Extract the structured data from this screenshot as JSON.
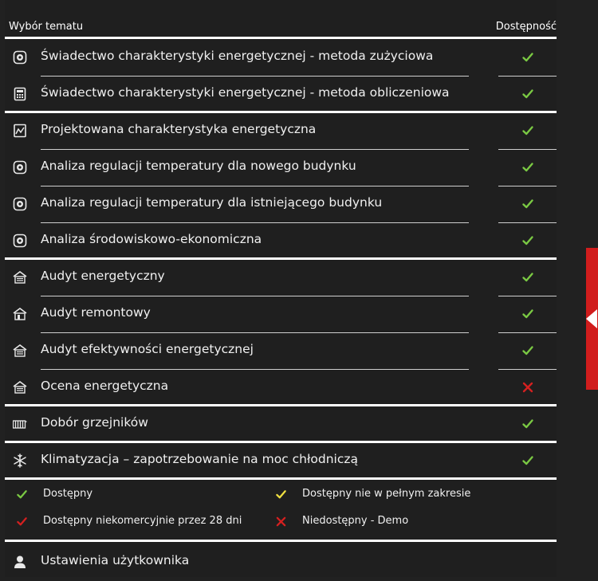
{
  "header": {
    "topic": "Wybór tematu",
    "availability": "Dostępność"
  },
  "colors": {
    "check": "#7ac943",
    "partial": "#f0e040",
    "noncommercial": "#d42020",
    "unavailable": "#d42020",
    "side_tab": "#d11d1d"
  },
  "topics": [
    {
      "label": "Świadectwo charakterystyki energetycznej - metoda zużyciowa",
      "icon": "meter-icon",
      "status": "available"
    },
    {
      "label": "Świadectwo charakterystyki energetycznej - metoda obliczeniowa",
      "icon": "calculator-icon",
      "status": "available"
    },
    {
      "label": "Projektowana charakterystyka energetyczna",
      "icon": "chart-doc-icon",
      "status": "available"
    },
    {
      "label": "Analiza regulacji temperatury dla nowego budynku",
      "icon": "meter-icon",
      "status": "available"
    },
    {
      "label": "Analiza regulacji temperatury dla istniejącego budynku",
      "icon": "meter-icon",
      "status": "available"
    },
    {
      "label": "Analiza środowiskowo-ekonomiczna",
      "icon": "meter-icon",
      "status": "available"
    },
    {
      "label": "Audyt energetyczny",
      "icon": "house-lines-icon",
      "status": "available"
    },
    {
      "label": "Audyt remontowy",
      "icon": "house-door-icon",
      "status": "available"
    },
    {
      "label": "Audyt efektywności energetycznej",
      "icon": "house-lines-icon",
      "status": "available"
    },
    {
      "label": "Ocena energetyczna",
      "icon": "house-lines-icon",
      "status": "unavailable"
    },
    {
      "label": "Dobór grzejników",
      "icon": "radiator-icon",
      "status": "available"
    },
    {
      "label": "Klimatyzacja – zapotrzebowanie na moc chłodniczą",
      "icon": "snowflake-icon",
      "status": "available"
    }
  ],
  "legend": {
    "available": "Dostępny",
    "partial": "Dostępny nie w pełnym zakresie",
    "noncommercial": "Dostępny niekomercyjnie przez 28 dni",
    "unavailable": "Niedostępny - Demo"
  },
  "user_settings": {
    "label": "Ustawienia użytkownika",
    "icon": "user-icon"
  }
}
